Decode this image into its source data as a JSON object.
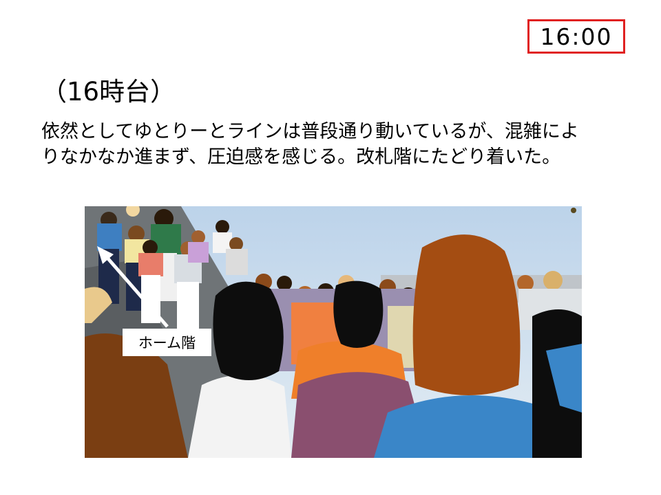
{
  "time": "16:00",
  "heading": "（16時台）",
  "description": {
    "line1": "依然としてゆとりーとラインは普段通り動いているが、混雑によ",
    "line2": "りなかなか進まず、圧迫感を感じる。改札階にたどり着いた。"
  },
  "scene": {
    "label": "ホーム階",
    "arrow_direction": "up-left",
    "colors": {
      "sky": "#c9dced",
      "time_border": "#e02020",
      "arrow": "#ffffff"
    }
  }
}
